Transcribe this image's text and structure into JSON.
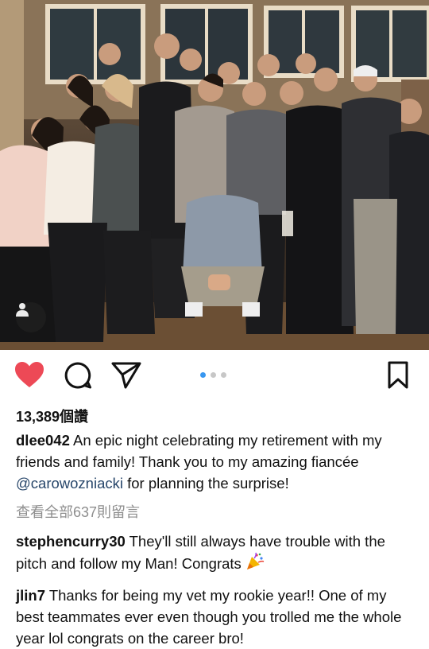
{
  "post": {
    "photo_alt": "",
    "tag_icon": "person-tag-icon"
  },
  "actions": {
    "like_icon": "heart-filled-icon",
    "like_color": "#ed4956",
    "comment_icon": "comment-bubble-icon",
    "share_icon": "paper-plane-icon",
    "bookmark_icon": "bookmark-icon",
    "carousel_total": 3,
    "carousel_active": 1,
    "carousel_active_color": "#3897f0"
  },
  "likes": {
    "text": "13,389個讚"
  },
  "caption": {
    "username": "dlee042",
    "text_before": "An epic night celebrating my retirement with my friends and family! Thank you to my amazing fiancée ",
    "mention": "@carowozniacki",
    "text_after": " for planning the surprise!"
  },
  "view_comments": {
    "text": "查看全部637則留言"
  },
  "comments": [
    {
      "username": "stephencurry30",
      "text": "They'll still always have trouble with the pitch and follow my Man! Congrats",
      "emoji": "party-popper-icon"
    },
    {
      "username": "jlin7",
      "text": "Thanks for being my vet my rookie year!! One of my best teammates ever even though you trolled me the whole year lol congrats on the career bro!"
    }
  ]
}
